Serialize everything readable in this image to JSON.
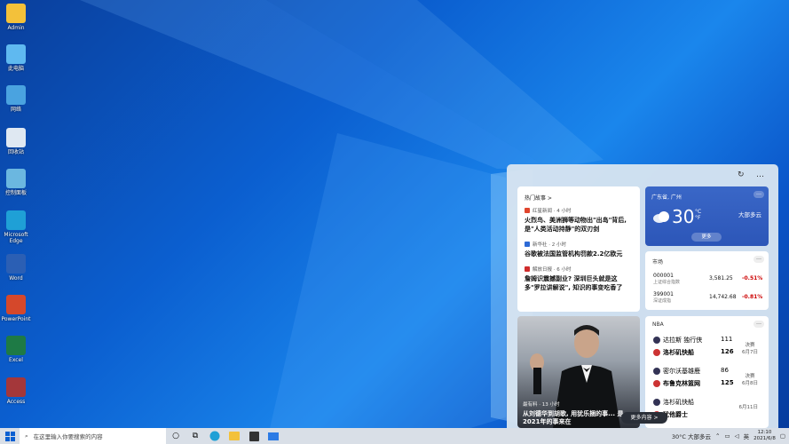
{
  "desktop": {
    "icons": [
      {
        "label": "Admin",
        "color": "#f3c13a"
      },
      {
        "label": "此电脑",
        "color": "#5fb9f0"
      },
      {
        "label": "网络",
        "color": "#4aa3e0"
      },
      {
        "label": "回收站",
        "color": "#dfe8f2"
      },
      {
        "label": "控制面板",
        "color": "#6bb7e0"
      },
      {
        "label": "Microsoft Edge",
        "color": "#1fa0d6"
      },
      {
        "label": "Word",
        "color": "#2b5fb4"
      },
      {
        "label": "PowerPoint",
        "color": "#d5482b"
      },
      {
        "label": "Excel",
        "color": "#1e7a45"
      },
      {
        "label": "Access",
        "color": "#a4373a"
      }
    ]
  },
  "widgets": {
    "news": {
      "header": "热门故事 >",
      "items": [
        {
          "source": "红星新闻 · 4 小时",
          "title": "火烈鸟、美洲狮等动物出\"出岛\"背后, 是\"人类活动持静\"的双刃剑",
          "color": "#e0452d"
        },
        {
          "source": "新华社 · 2 小时",
          "title": "谷歌被法国监管机构罚款2.2亿欧元",
          "color": "#2d6ad6"
        },
        {
          "source": "解放日报 · 6 小时",
          "title": "詹姆识震撼副业? 深圳巨头就是这多\"罗拉讲解说\", 知识的事变吃香了",
          "color": "#d02d2d"
        }
      ]
    },
    "weather": {
      "location": "广东省, 广州",
      "temp": "30",
      "unit": "°C\n°F",
      "condition": "大部多云",
      "more": "更多"
    },
    "market": {
      "label": "市场",
      "rows": [
        {
          "code": "000001",
          "name": "上证综合指数",
          "value": "3,581.25",
          "pct": "-0.51%"
        },
        {
          "code": "399001",
          "name": "深证成指",
          "value": "14,742.68",
          "pct": "-0.81%"
        }
      ]
    },
    "nba": {
      "label": "NBA",
      "games": [
        {
          "t1": "达拉斯 独行侠",
          "s1": "111",
          "t2": "洛杉矶快船",
          "s2": "126",
          "status": "决赛",
          "date": "6月7日"
        },
        {
          "t1": "密尔沃基雄鹿",
          "s1": "86",
          "t2": "布鲁克林篮网",
          "s2": "125",
          "status": "决赛",
          "date": "6月8日"
        },
        {
          "t1": "洛杉矶快船",
          "s1": "",
          "t2": "犹他爵士",
          "s2": "",
          "status": "6月11日",
          "date": ""
        }
      ]
    },
    "photo_news": {
      "source": "最有料 · 13 小时",
      "title": "从刘德华到胡歌, 用犹乐捆的事... 是2021年的事来在"
    },
    "more_content": "更多内容 >"
  },
  "taskbar": {
    "search_placeholder": "在这里输入你要搜索的内容",
    "weather": "30°C 大部多云",
    "lang": "英",
    "time": "12:10",
    "date": "2021/6/8"
  }
}
